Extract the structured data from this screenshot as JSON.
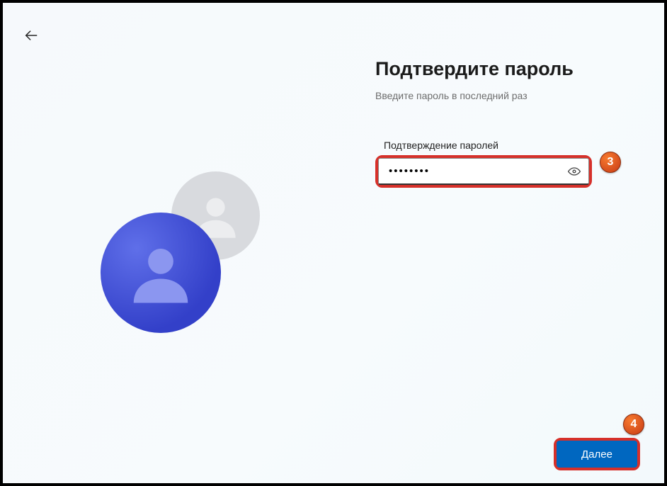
{
  "title": "Подтвердите пароль",
  "subtitle": "Введите пароль в последний раз",
  "field": {
    "label": "Подтверждение паролей",
    "value": "••••••••"
  },
  "buttons": {
    "next": "Далее"
  },
  "callouts": {
    "input": "3",
    "next": "4"
  },
  "icons": {
    "back": "arrow-left",
    "reveal": "eye"
  }
}
